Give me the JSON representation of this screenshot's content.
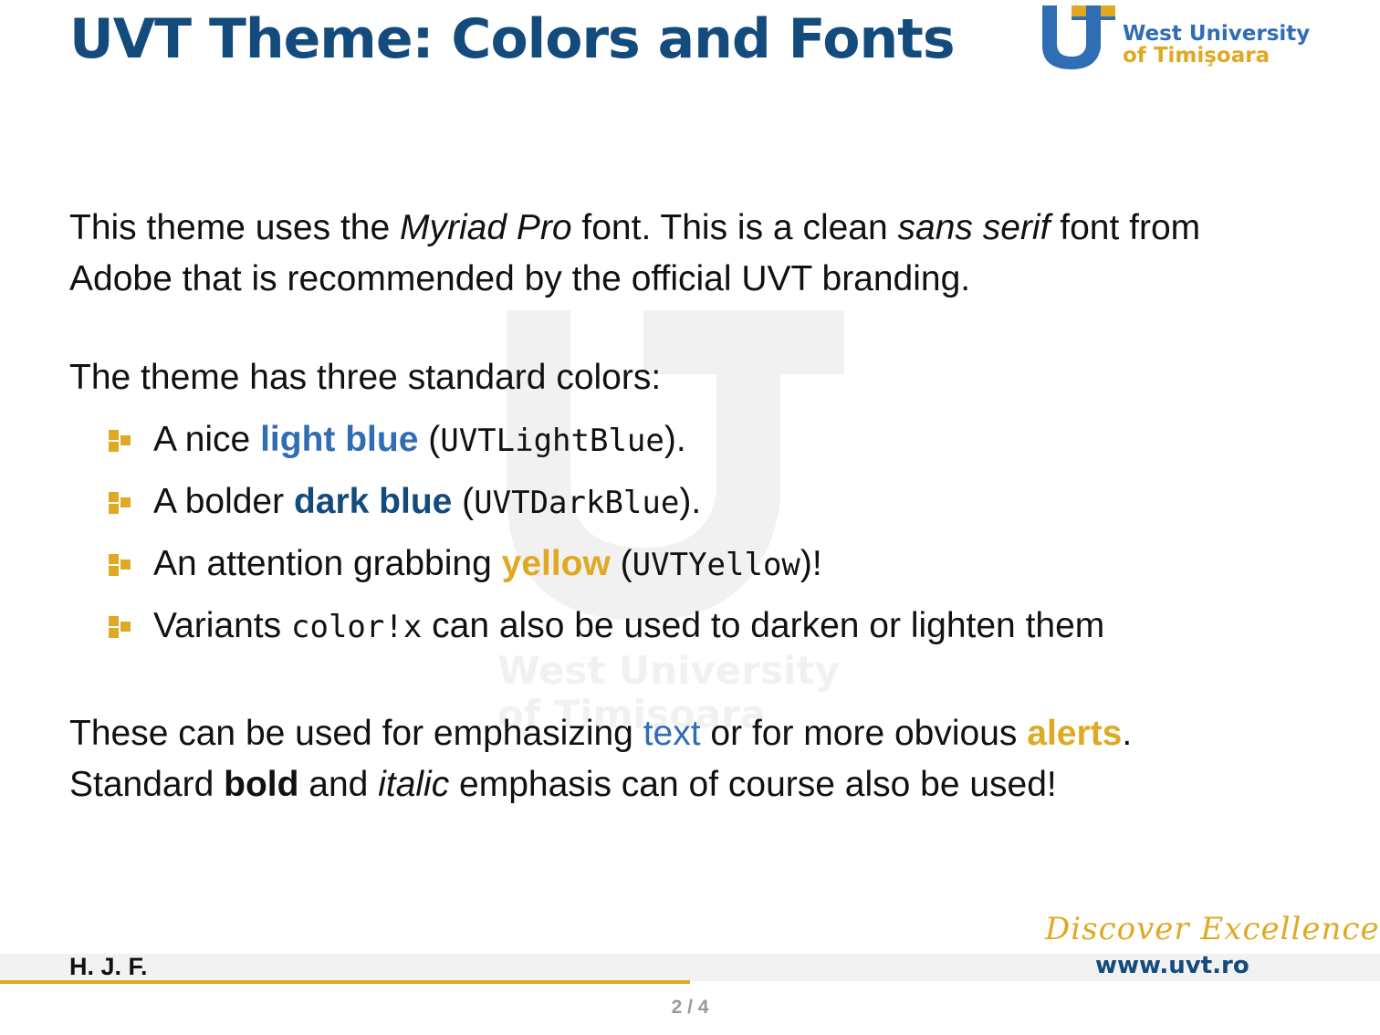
{
  "title": "UVT Theme: Colors and Fonts",
  "logo": {
    "line1": "West University",
    "line2": "of Timişoara"
  },
  "paragraph1": {
    "t1": "This theme uses the ",
    "font_name": "Myriad Pro",
    "t2": " font. This is a clean ",
    "sans_serif": "sans serif",
    "t3": " font from Adobe that is recommended by the official UVT branding."
  },
  "paragraph2": "The theme has three standard colors:",
  "bullets": [
    {
      "pre": "A nice ",
      "emph": "light blue",
      "open": " (",
      "code": "UVTLightBlue",
      "close": ")."
    },
    {
      "pre": "A bolder ",
      "emph": "dark blue",
      "open": " (",
      "code": "UVTDarkBlue",
      "close": ")."
    },
    {
      "pre": "An attention grabbing ",
      "emph": "yellow",
      "open": " (",
      "code": "UVTYellow",
      "close": ")!"
    },
    {
      "pre": "Variants ",
      "code": "color!x",
      "post": " can also be used to darken or lighten them"
    }
  ],
  "paragraph3": {
    "t1": "These can be used for emphasizing ",
    "text_word": "text",
    "t2": " or for more obvious ",
    "alerts_word": "alerts",
    "t3": ".",
    "t4": "Standard ",
    "bold_word": "bold",
    "t5": " and ",
    "italic_word": "italic",
    "t6": " emphasis can of course also be used!"
  },
  "footer": {
    "author": "H. J. F.",
    "slogan": "Discover Excellence!",
    "website": "www.uvt.ro",
    "page": "2 / 4"
  },
  "colors": {
    "light_blue": "#2f6db5",
    "dark_blue": "#144b7d",
    "yellow": "#e0a924"
  },
  "icons": {
    "bullet": "uvt-square-bullet-icon"
  }
}
